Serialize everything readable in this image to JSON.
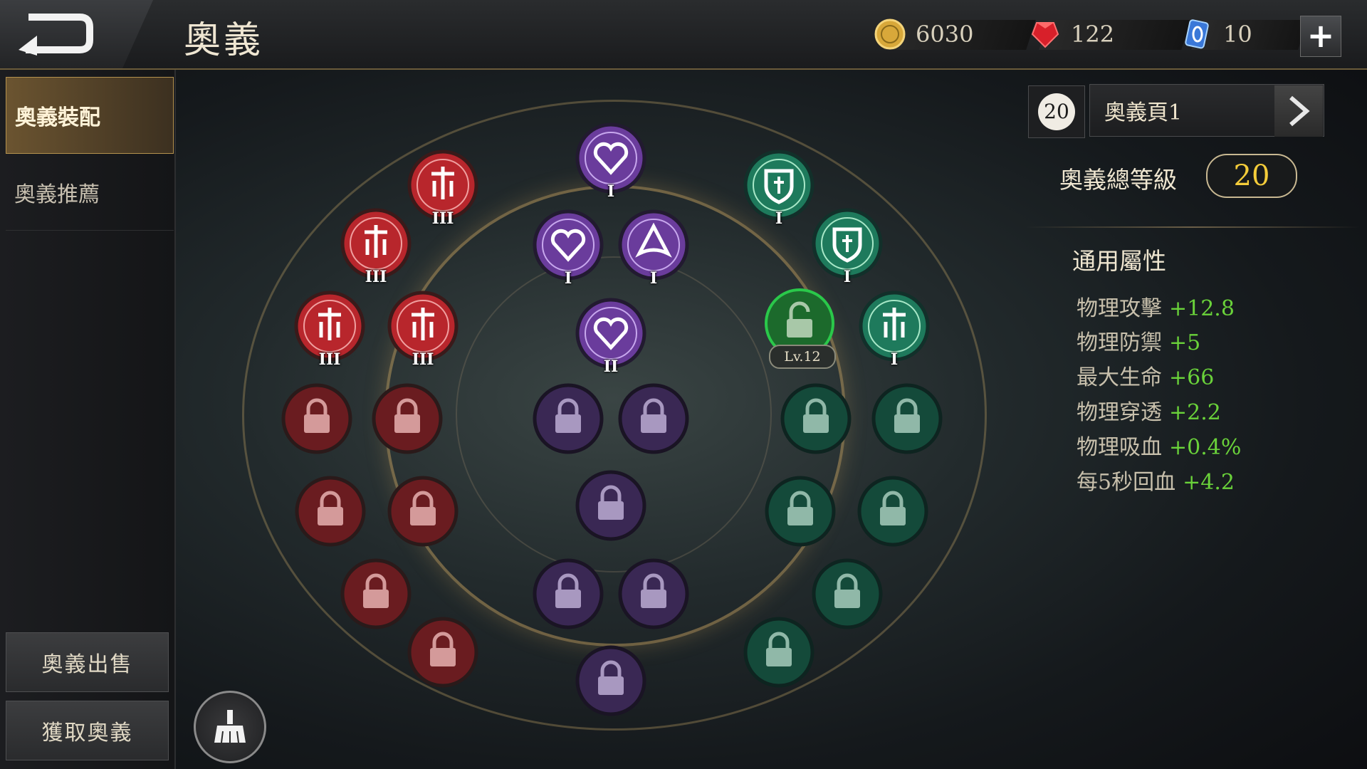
{
  "header": {
    "title": "奧義",
    "gold": "6030",
    "gems": "122",
    "vouchers": "10"
  },
  "sidebar": {
    "items": [
      {
        "label": "奧義裝配",
        "active": true
      },
      {
        "label": "奧義推薦",
        "active": false
      }
    ],
    "sell_label": "奧義出售",
    "obtain_label": "獲取奧義"
  },
  "tree": {
    "red_ranks": [
      "III",
      "III",
      "III",
      "III"
    ],
    "purple_ranks": [
      "I",
      "I",
      "I",
      "II"
    ],
    "green_ranks": [
      "I",
      "I",
      "I"
    ],
    "unlock_level": "Lv.12"
  },
  "panel": {
    "page_count": "20",
    "page_name": "奧義頁1",
    "total_label": "奧義總等級",
    "total_value": "20",
    "attr_title": "通用屬性",
    "attributes": [
      {
        "name": "物理攻擊",
        "value": "+12.8"
      },
      {
        "name": "物理防禦",
        "value": "+5"
      },
      {
        "name": "最大生命",
        "value": "+66"
      },
      {
        "name": "物理穿透",
        "value": "+2.2"
      },
      {
        "name": "物理吸血",
        "value": "+0.4%"
      },
      {
        "name": "每5秒回血",
        "value": "+4.2"
      }
    ]
  },
  "colors": {
    "red": "#b8262c",
    "purple": "#6a3c9c",
    "green": "#1e7a5c",
    "stat_green": "#6ad23a",
    "gold_text": "#f4cc3a"
  }
}
